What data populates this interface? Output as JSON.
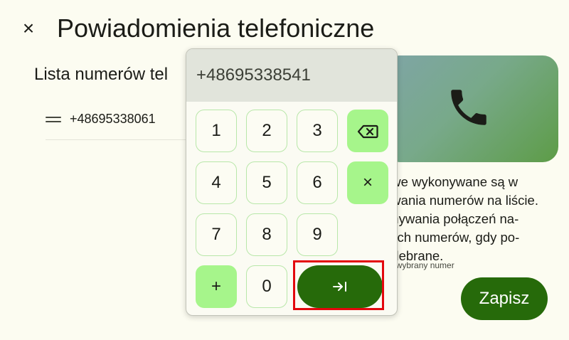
{
  "header": {
    "close_glyph": "×",
    "title": "Powiadomienia telefoniczne"
  },
  "list": {
    "heading": "Lista numerów tel",
    "numbers": [
      "+48695338061"
    ]
  },
  "info": {
    "lines": [
      "owe wykonywane są w",
      "owania numerów na liście.",
      "onywania połączeń na-",
      "tkich numerów, gdy po-",
      "odebrane."
    ],
    "hint": "na wybrany numer"
  },
  "save_label": "Zapisz",
  "keypad": {
    "display_value": "+48695338541",
    "digits": [
      "1",
      "2",
      "3",
      "4",
      "5",
      "6",
      "7",
      "8",
      "9",
      "0"
    ],
    "plus_label": "+",
    "clear_label": "×",
    "backspace_icon": "backspace-icon",
    "enter_icon": "tab-next-icon",
    "enter_glyph": "→|"
  },
  "colors": {
    "primary": "#266a0a",
    "accent_key": "#a6f58b",
    "highlight": "#e3070d",
    "background": "#fcfcf1"
  }
}
